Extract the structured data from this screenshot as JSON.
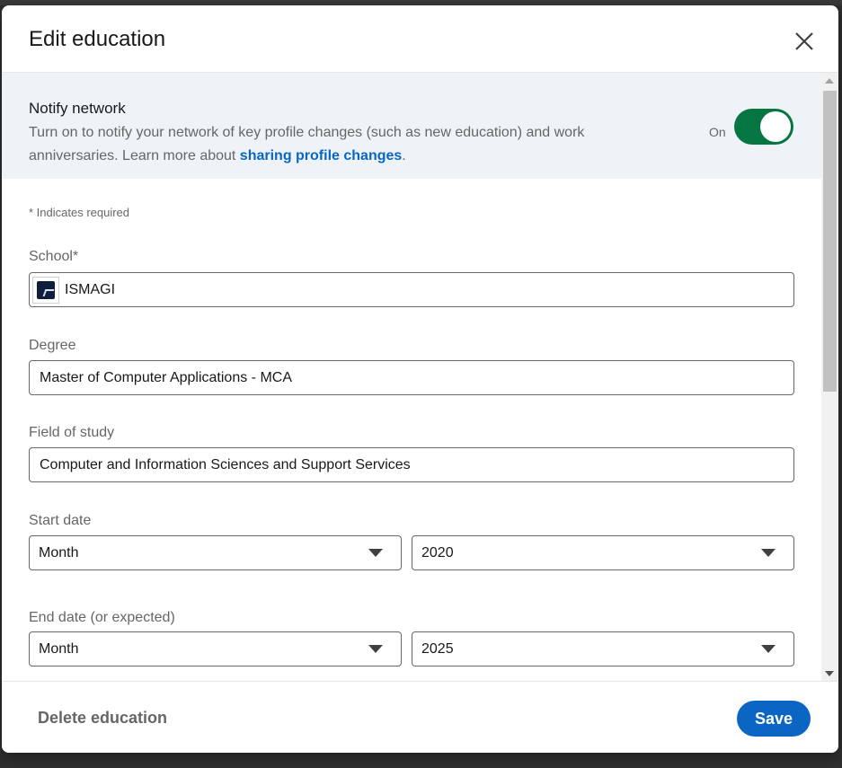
{
  "modal": {
    "title": "Edit education",
    "close_icon": "close-icon"
  },
  "notify": {
    "title": "Notify network",
    "description": "Turn on to notify your network of key profile changes (such as new education) and work anniversaries. Learn more about ",
    "link_text": "sharing profile changes",
    "description_end": ".",
    "toggle_label": "On",
    "toggle_on": true
  },
  "form": {
    "required_note": "* Indicates required",
    "school": {
      "label": "School*",
      "value": "ISMAGI",
      "logo_icon": "school-logo-icon"
    },
    "degree": {
      "label": "Degree",
      "value": "Master of Computer Applications - MCA"
    },
    "field_of_study": {
      "label": "Field of study",
      "value": "Computer and Information Sciences and Support Services"
    },
    "start_date": {
      "label": "Start date",
      "month": "Month",
      "year": "2020"
    },
    "end_date": {
      "label": "End date (or expected)",
      "month": "Month",
      "year": "2025"
    }
  },
  "footer": {
    "delete_label": "Delete education",
    "save_label": "Save"
  },
  "colors": {
    "primary": "#0a66c2",
    "toggle_on": "#057642",
    "notify_bg": "#eef3f8"
  }
}
